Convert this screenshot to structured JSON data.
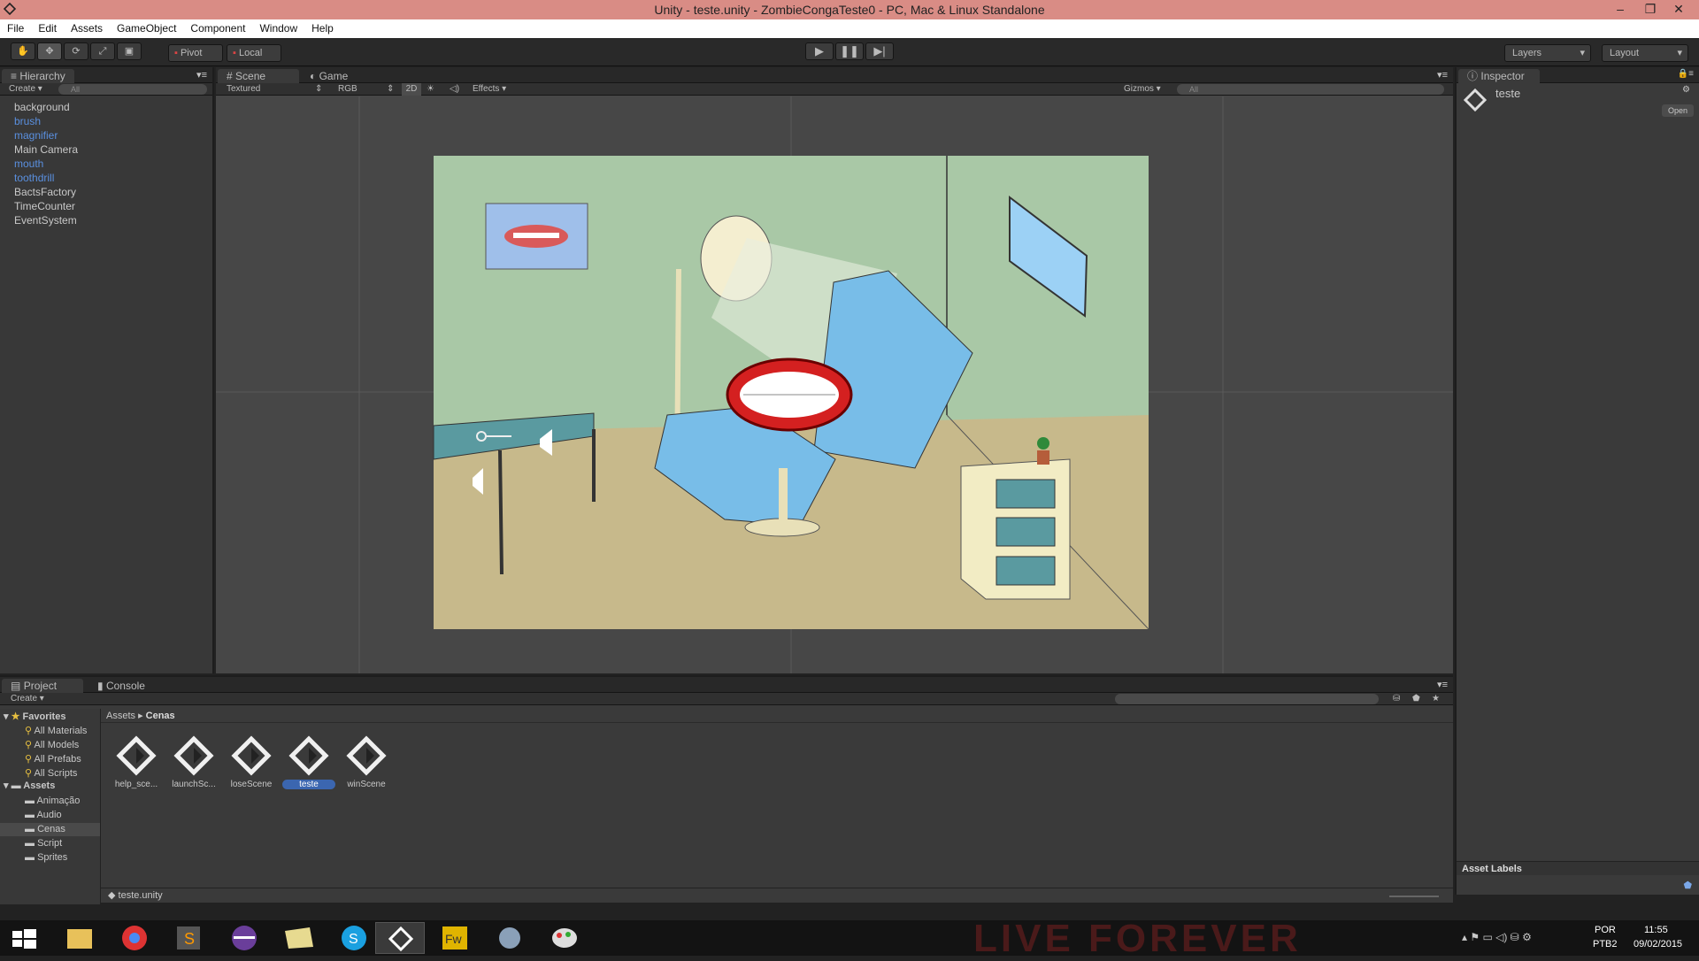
{
  "window": {
    "title": "Unity - teste.unity - ZombieCongaTeste0 - PC, Mac & Linux Standalone",
    "minimize": "–",
    "maximize": "❐",
    "close": "✕"
  },
  "menu": [
    "File",
    "Edit",
    "Assets",
    "GameObject",
    "Component",
    "Window",
    "Help"
  ],
  "toolbar": {
    "pivot": "Pivot",
    "local": "Local",
    "layers": "Layers",
    "layout": "Layout"
  },
  "hierarchy": {
    "tab": "Hierarchy",
    "create": "Create",
    "search": "All",
    "items": [
      {
        "label": "background",
        "prefab": false
      },
      {
        "label": "brush",
        "prefab": true
      },
      {
        "label": "magnifier",
        "prefab": true
      },
      {
        "label": "Main Camera",
        "prefab": false
      },
      {
        "label": "mouth",
        "prefab": true
      },
      {
        "label": "toothdrill",
        "prefab": true
      },
      {
        "label": "BactsFactory",
        "prefab": false
      },
      {
        "label": "TimeCounter",
        "prefab": false
      },
      {
        "label": "EventSystem",
        "prefab": false
      }
    ]
  },
  "scene": {
    "tab_scene": "Scene",
    "tab_game": "Game",
    "render_mode": "Textured",
    "color_mode": "RGB",
    "mode_2d": "2D",
    "effects": "Effects",
    "gizmos": "Gizmos",
    "search": "All"
  },
  "inspector": {
    "tab": "Inspector",
    "object": "teste",
    "open": "Open",
    "asset_labels": "Asset Labels"
  },
  "project": {
    "tab_project": "Project",
    "tab_console": "Console",
    "create": "Create",
    "breadcrumb": [
      "Assets",
      "Cenas"
    ],
    "favorites": {
      "title": "Favorites",
      "items": [
        "All Materials",
        "All Models",
        "All Prefabs",
        "All Scripts"
      ]
    },
    "assets": {
      "title": "Assets",
      "items": [
        "Animação",
        "Audio",
        "Cenas",
        "Script",
        "Sprites"
      ],
      "selected": "Cenas"
    },
    "files": [
      {
        "label": "help_sce...",
        "selected": false
      },
      {
        "label": "launchSc...",
        "selected": false
      },
      {
        "label": "loseScene",
        "selected": false
      },
      {
        "label": "teste",
        "selected": true
      },
      {
        "label": "winScene",
        "selected": false
      }
    ],
    "status_file": "teste.unity"
  },
  "taskbar": {
    "lang1": "POR",
    "lang2": "PTB2",
    "time": "11:55",
    "date": "09/02/2015",
    "bg_text": "LIVE FOREVER"
  },
  "colors": {
    "accent": "#3b66b0",
    "prefab_text": "#5a90e0",
    "titlebar": "#d98c85"
  }
}
